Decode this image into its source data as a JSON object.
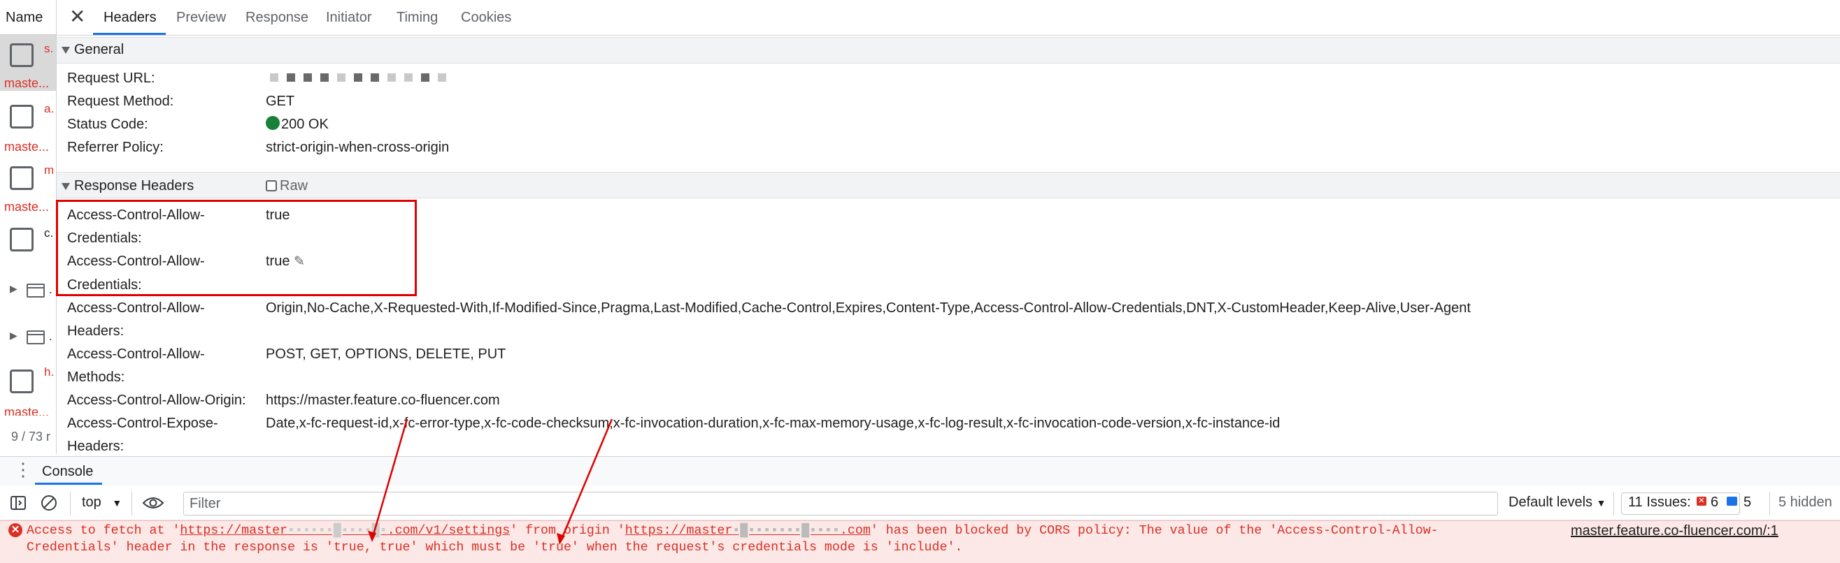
{
  "sidebar": {
    "header": "Name",
    "rows": [
      {
        "name": "s.",
        "sub": "maste..."
      },
      {
        "name": "a.",
        "sub": "maste..."
      },
      {
        "name": "m",
        "sub": "maste..."
      },
      {
        "name": "c."
      },
      {
        "name": "."
      },
      {
        "name": "."
      },
      {
        "name": "h.",
        "sub": "maste..."
      }
    ],
    "count": "9 / 73 r"
  },
  "tabs": [
    "Headers",
    "Preview",
    "Response",
    "Initiator",
    "Timing",
    "Cookies"
  ],
  "general": {
    "title": "General",
    "rows": [
      {
        "key": "Request URL:",
        "value": ""
      },
      {
        "key": "Request Method:",
        "value": "GET"
      },
      {
        "key": "Status Code:",
        "value": "200 OK"
      },
      {
        "key": "Referrer Policy:",
        "value": "strict-origin-when-cross-origin"
      }
    ]
  },
  "response_headers": {
    "title": "Response Headers",
    "raw_label": "Raw",
    "rows": [
      {
        "key1": "Access-Control-Allow-",
        "key2": "Credentials:",
        "value": "true"
      },
      {
        "key1": "Access-Control-Allow-",
        "key2": "Credentials:",
        "value": "true"
      },
      {
        "key1": "Access-Control-Allow-",
        "key2": "Headers:",
        "value": "Origin,No-Cache,X-Requested-With,If-Modified-Since,Pragma,Last-Modified,Cache-Control,Expires,Content-Type,Access-Control-Allow-Credentials,DNT,X-CustomHeader,Keep-Alive,User-Agent"
      },
      {
        "key1": "Access-Control-Allow-",
        "key2": "Methods:",
        "value": "POST, GET, OPTIONS, DELETE, PUT"
      },
      {
        "key1": "Access-Control-Allow-Origin:",
        "key2": "",
        "value": "https://master.feature.co-fluencer.com"
      },
      {
        "key1": "Access-Control-Expose-",
        "key2": "Headers:",
        "value": "Date,x-fc-request-id,x-fc-error-type,x-fc-code-checksum,x-fc-invocation-duration,x-fc-max-memory-usage,x-fc-log-result,x-fc-invocation-code-version,x-fc-instance-id"
      }
    ]
  },
  "console": {
    "tab": "Console",
    "context": "top",
    "filter_placeholder": "Filter",
    "levels": "Default levels",
    "issues_label": "11 Issues:",
    "issues_errors": "6",
    "issues_messages": "5",
    "hidden": "5 hidden",
    "error": {
      "l1_a": "Access to fetch at '",
      "l1_url1a": "https://master",
      "l1_url1b": ".com/v1/settings",
      "l1_b": "' from origin '",
      "l1_url2a": "https://master",
      "l1_url2b": ".com",
      "l1_c": "' has been blocked by CORS policy: The value of the 'Access-Control-Allow-",
      "l2": "Credentials' header in the response is 'true, true' which must be 'true' when the request's credentials mode is 'include'.",
      "source": "master.feature.co-fluencer.com/:1"
    }
  },
  "colors": {
    "error": "#d93025",
    "accent": "#1a73e8",
    "status_ok": "#188038",
    "annotation": "#e00000"
  }
}
